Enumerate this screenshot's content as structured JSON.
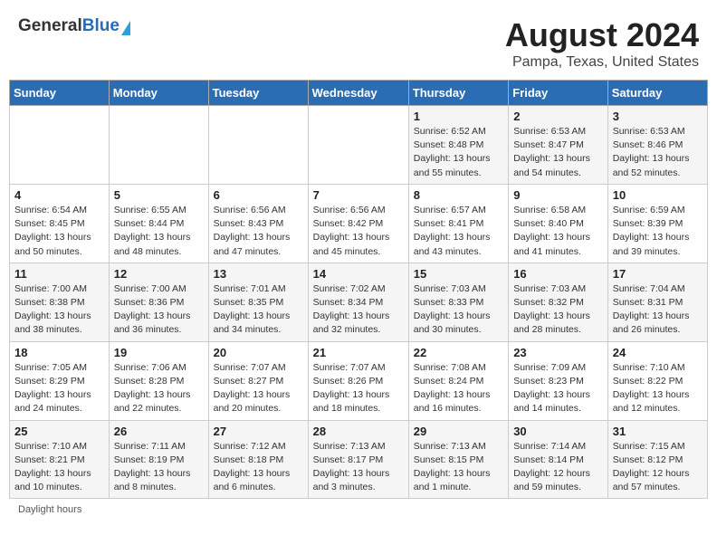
{
  "header": {
    "logo_general": "General",
    "logo_blue": "Blue",
    "title": "August 2024",
    "subtitle": "Pampa, Texas, United States"
  },
  "days_of_week": [
    "Sunday",
    "Monday",
    "Tuesday",
    "Wednesday",
    "Thursday",
    "Friday",
    "Saturday"
  ],
  "weeks": [
    [
      {
        "day": "",
        "info": ""
      },
      {
        "day": "",
        "info": ""
      },
      {
        "day": "",
        "info": ""
      },
      {
        "day": "",
        "info": ""
      },
      {
        "day": "1",
        "info": "Sunrise: 6:52 AM\nSunset: 8:48 PM\nDaylight: 13 hours and 55 minutes."
      },
      {
        "day": "2",
        "info": "Sunrise: 6:53 AM\nSunset: 8:47 PM\nDaylight: 13 hours and 54 minutes."
      },
      {
        "day": "3",
        "info": "Sunrise: 6:53 AM\nSunset: 8:46 PM\nDaylight: 13 hours and 52 minutes."
      }
    ],
    [
      {
        "day": "4",
        "info": "Sunrise: 6:54 AM\nSunset: 8:45 PM\nDaylight: 13 hours and 50 minutes."
      },
      {
        "day": "5",
        "info": "Sunrise: 6:55 AM\nSunset: 8:44 PM\nDaylight: 13 hours and 48 minutes."
      },
      {
        "day": "6",
        "info": "Sunrise: 6:56 AM\nSunset: 8:43 PM\nDaylight: 13 hours and 47 minutes."
      },
      {
        "day": "7",
        "info": "Sunrise: 6:56 AM\nSunset: 8:42 PM\nDaylight: 13 hours and 45 minutes."
      },
      {
        "day": "8",
        "info": "Sunrise: 6:57 AM\nSunset: 8:41 PM\nDaylight: 13 hours and 43 minutes."
      },
      {
        "day": "9",
        "info": "Sunrise: 6:58 AM\nSunset: 8:40 PM\nDaylight: 13 hours and 41 minutes."
      },
      {
        "day": "10",
        "info": "Sunrise: 6:59 AM\nSunset: 8:39 PM\nDaylight: 13 hours and 39 minutes."
      }
    ],
    [
      {
        "day": "11",
        "info": "Sunrise: 7:00 AM\nSunset: 8:38 PM\nDaylight: 13 hours and 38 minutes."
      },
      {
        "day": "12",
        "info": "Sunrise: 7:00 AM\nSunset: 8:36 PM\nDaylight: 13 hours and 36 minutes."
      },
      {
        "day": "13",
        "info": "Sunrise: 7:01 AM\nSunset: 8:35 PM\nDaylight: 13 hours and 34 minutes."
      },
      {
        "day": "14",
        "info": "Sunrise: 7:02 AM\nSunset: 8:34 PM\nDaylight: 13 hours and 32 minutes."
      },
      {
        "day": "15",
        "info": "Sunrise: 7:03 AM\nSunset: 8:33 PM\nDaylight: 13 hours and 30 minutes."
      },
      {
        "day": "16",
        "info": "Sunrise: 7:03 AM\nSunset: 8:32 PM\nDaylight: 13 hours and 28 minutes."
      },
      {
        "day": "17",
        "info": "Sunrise: 7:04 AM\nSunset: 8:31 PM\nDaylight: 13 hours and 26 minutes."
      }
    ],
    [
      {
        "day": "18",
        "info": "Sunrise: 7:05 AM\nSunset: 8:29 PM\nDaylight: 13 hours and 24 minutes."
      },
      {
        "day": "19",
        "info": "Sunrise: 7:06 AM\nSunset: 8:28 PM\nDaylight: 13 hours and 22 minutes."
      },
      {
        "day": "20",
        "info": "Sunrise: 7:07 AM\nSunset: 8:27 PM\nDaylight: 13 hours and 20 minutes."
      },
      {
        "day": "21",
        "info": "Sunrise: 7:07 AM\nSunset: 8:26 PM\nDaylight: 13 hours and 18 minutes."
      },
      {
        "day": "22",
        "info": "Sunrise: 7:08 AM\nSunset: 8:24 PM\nDaylight: 13 hours and 16 minutes."
      },
      {
        "day": "23",
        "info": "Sunrise: 7:09 AM\nSunset: 8:23 PM\nDaylight: 13 hours and 14 minutes."
      },
      {
        "day": "24",
        "info": "Sunrise: 7:10 AM\nSunset: 8:22 PM\nDaylight: 13 hours and 12 minutes."
      }
    ],
    [
      {
        "day": "25",
        "info": "Sunrise: 7:10 AM\nSunset: 8:21 PM\nDaylight: 13 hours and 10 minutes."
      },
      {
        "day": "26",
        "info": "Sunrise: 7:11 AM\nSunset: 8:19 PM\nDaylight: 13 hours and 8 minutes."
      },
      {
        "day": "27",
        "info": "Sunrise: 7:12 AM\nSunset: 8:18 PM\nDaylight: 13 hours and 6 minutes."
      },
      {
        "day": "28",
        "info": "Sunrise: 7:13 AM\nSunset: 8:17 PM\nDaylight: 13 hours and 3 minutes."
      },
      {
        "day": "29",
        "info": "Sunrise: 7:13 AM\nSunset: 8:15 PM\nDaylight: 13 hours and 1 minute."
      },
      {
        "day": "30",
        "info": "Sunrise: 7:14 AM\nSunset: 8:14 PM\nDaylight: 12 hours and 59 minutes."
      },
      {
        "day": "31",
        "info": "Sunrise: 7:15 AM\nSunset: 8:12 PM\nDaylight: 12 hours and 57 minutes."
      }
    ]
  ],
  "footer": "Daylight hours"
}
